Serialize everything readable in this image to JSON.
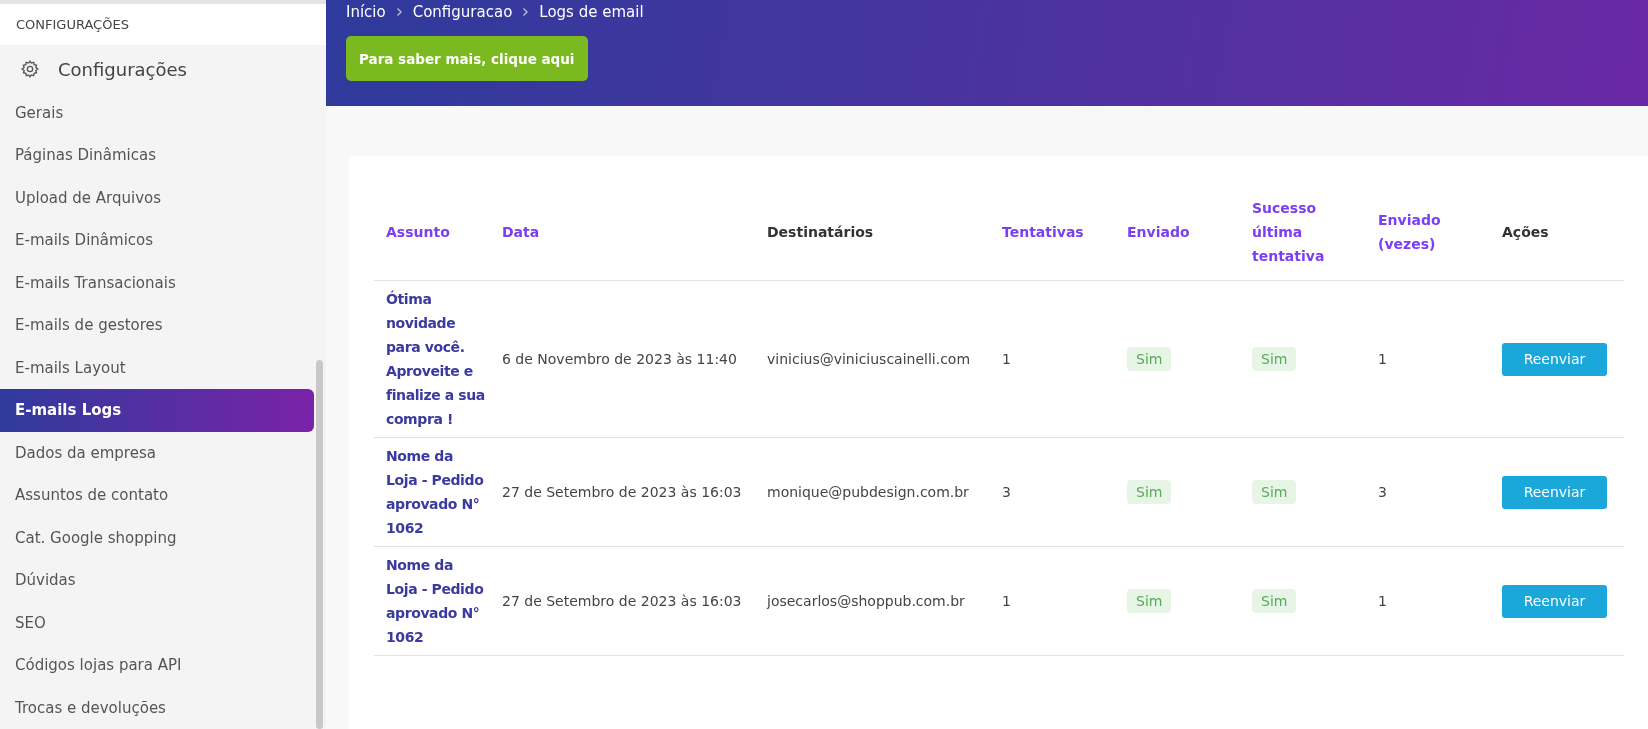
{
  "sidebar": {
    "section_title": "CONFIGURAÇÕES",
    "group_label": "Configurações",
    "items": [
      {
        "label": "Gerais",
        "selected": false
      },
      {
        "label": "Páginas Dinâmicas",
        "selected": false
      },
      {
        "label": "Upload de Arquivos",
        "selected": false
      },
      {
        "label": "E-mails Dinâmicos",
        "selected": false
      },
      {
        "label": "E-mails Transacionais",
        "selected": false
      },
      {
        "label": "E-mails de gestores",
        "selected": false
      },
      {
        "label": "E-mails Layout",
        "selected": false
      },
      {
        "label": "E-mails Logs",
        "selected": true
      },
      {
        "label": "Dados da empresa",
        "selected": false
      },
      {
        "label": "Assuntos de contato",
        "selected": false
      },
      {
        "label": "Cat. Google shopping",
        "selected": false
      },
      {
        "label": "Dúvidas",
        "selected": false
      },
      {
        "label": "SEO",
        "selected": false
      },
      {
        "label": "Códigos lojas para API",
        "selected": false
      },
      {
        "label": "Trocas e devoluções",
        "selected": false
      }
    ]
  },
  "breadcrumb": [
    "Início",
    "Configuracao",
    "Logs de email"
  ],
  "help_button": "Para saber mais, clique aqui",
  "table": {
    "columns": [
      {
        "label": "Assunto",
        "sortable": true
      },
      {
        "label": "Data",
        "sortable": true
      },
      {
        "label": "Destinatários",
        "sortable": false
      },
      {
        "label": "Tentativas",
        "sortable": true
      },
      {
        "label": "Enviado",
        "sortable": true
      },
      {
        "label": "Sucesso última tentativa",
        "sortable": true
      },
      {
        "label": "Enviado (vezes)",
        "sortable": true
      },
      {
        "label": "Ações",
        "sortable": false
      }
    ],
    "rows": [
      {
        "assunto": "Ótima novidade para você. Aproveite e finalize a sua compra !",
        "data": "6 de Novembro de 2023 às 11:40",
        "destinatarios": "vinicius@viniciuscainelli.com",
        "tentativas": "1",
        "enviado": "Sim",
        "sucesso": "Sim",
        "vezes": "1",
        "action": "Reenviar"
      },
      {
        "assunto": "Nome da Loja - Pedido aprovado N° 1062",
        "data": "27 de Setembro de 2023 às 16:03",
        "destinatarios": "monique@pubdesign.com.br",
        "tentativas": "3",
        "enviado": "Sim",
        "sucesso": "Sim",
        "vezes": "3",
        "action": "Reenviar"
      },
      {
        "assunto": "Nome da Loja - Pedido aprovado N° 1062",
        "data": "27 de Setembro de 2023 às 16:03",
        "destinatarios": "josecarlos@shoppub.com.br",
        "tentativas": "1",
        "enviado": "Sim",
        "sucesso": "Sim",
        "vezes": "1",
        "action": "Reenviar"
      }
    ]
  }
}
